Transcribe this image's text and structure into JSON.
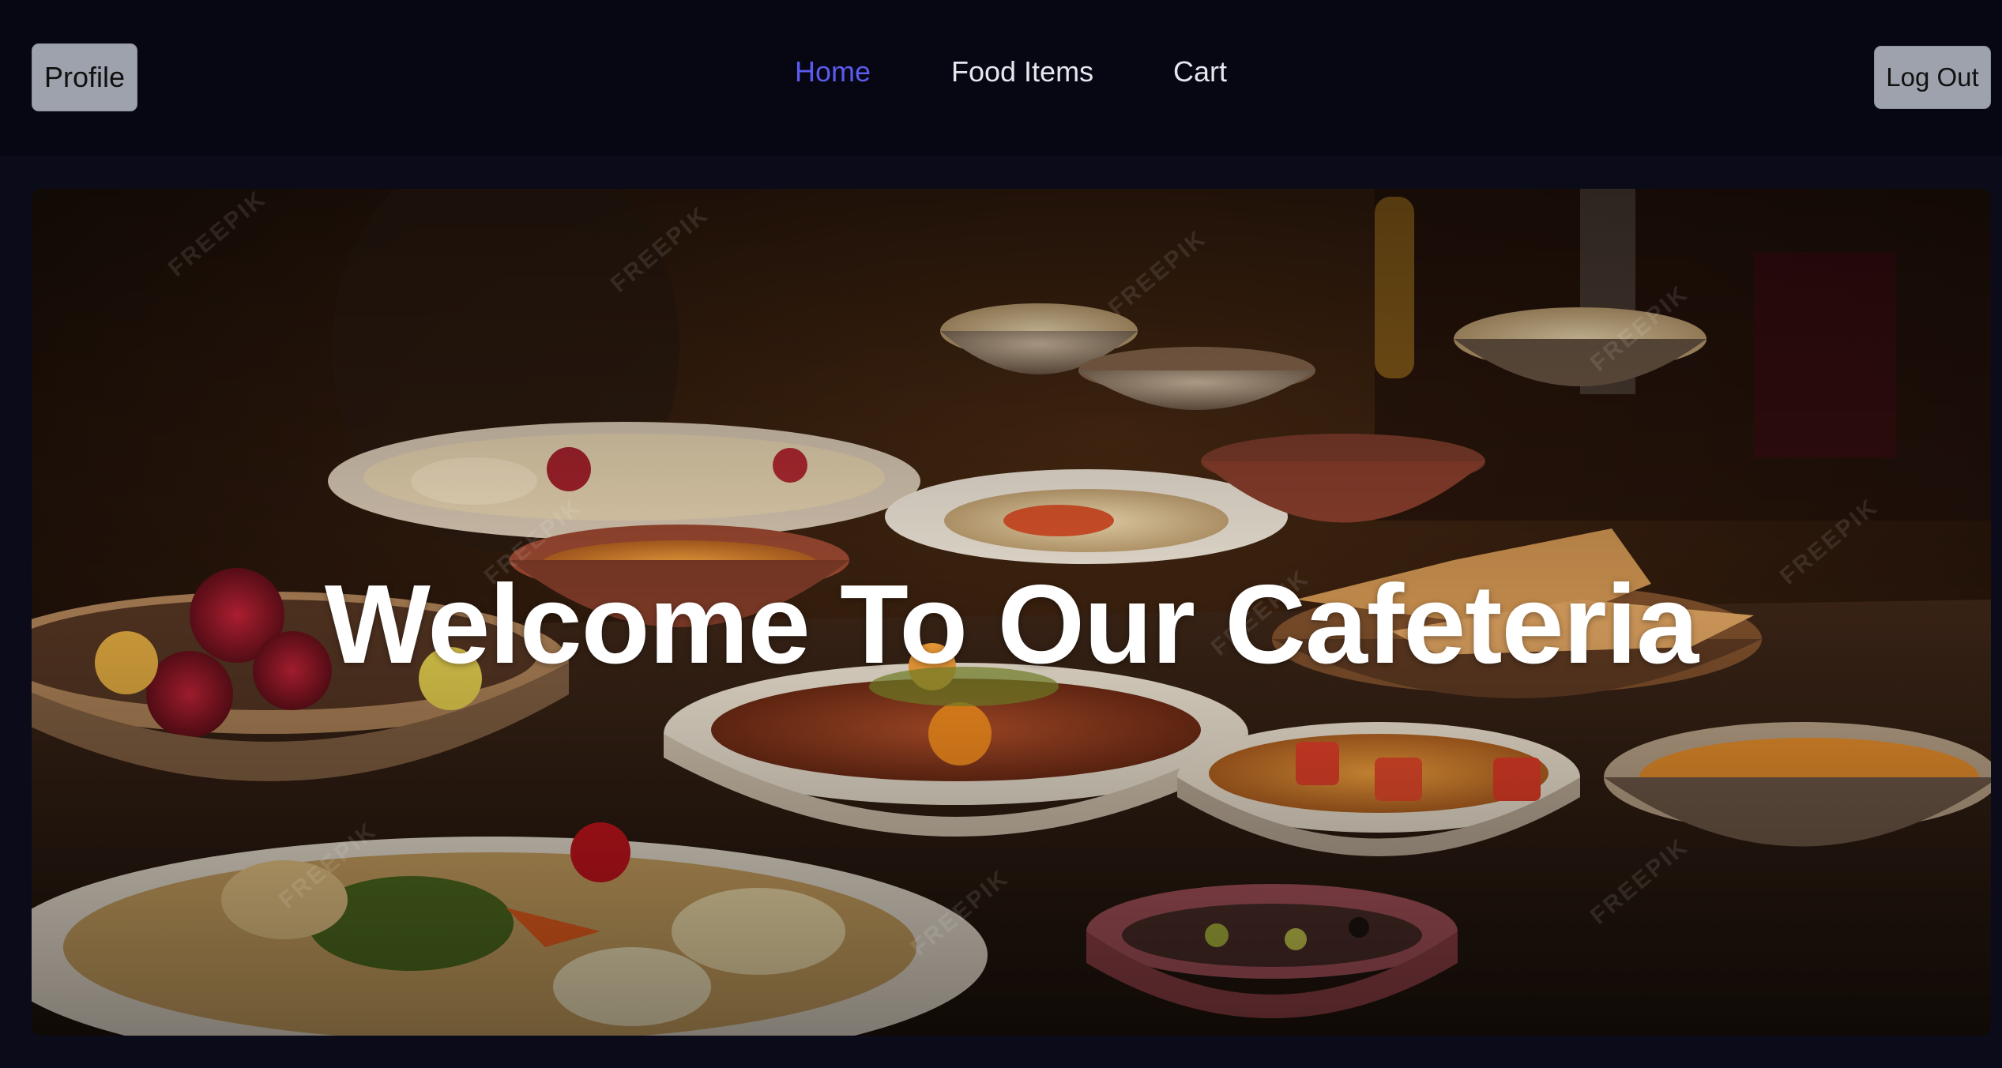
{
  "header": {
    "profile_label": "Profile",
    "logout_label": "Log Out",
    "nav": [
      {
        "label": "Home",
        "active": true
      },
      {
        "label": "Food Items",
        "active": false
      },
      {
        "label": "Cart",
        "active": false
      }
    ]
  },
  "hero": {
    "title": "Welcome To Our Cafeteria",
    "image": "food-banquet-photo",
    "watermark": "FREEPIK"
  },
  "colors": {
    "background": "#0b0b1a",
    "navbar": "#070613",
    "button": "#9ea2ad",
    "active_link": "#5b5bf0",
    "link": "#e6e6ec"
  }
}
